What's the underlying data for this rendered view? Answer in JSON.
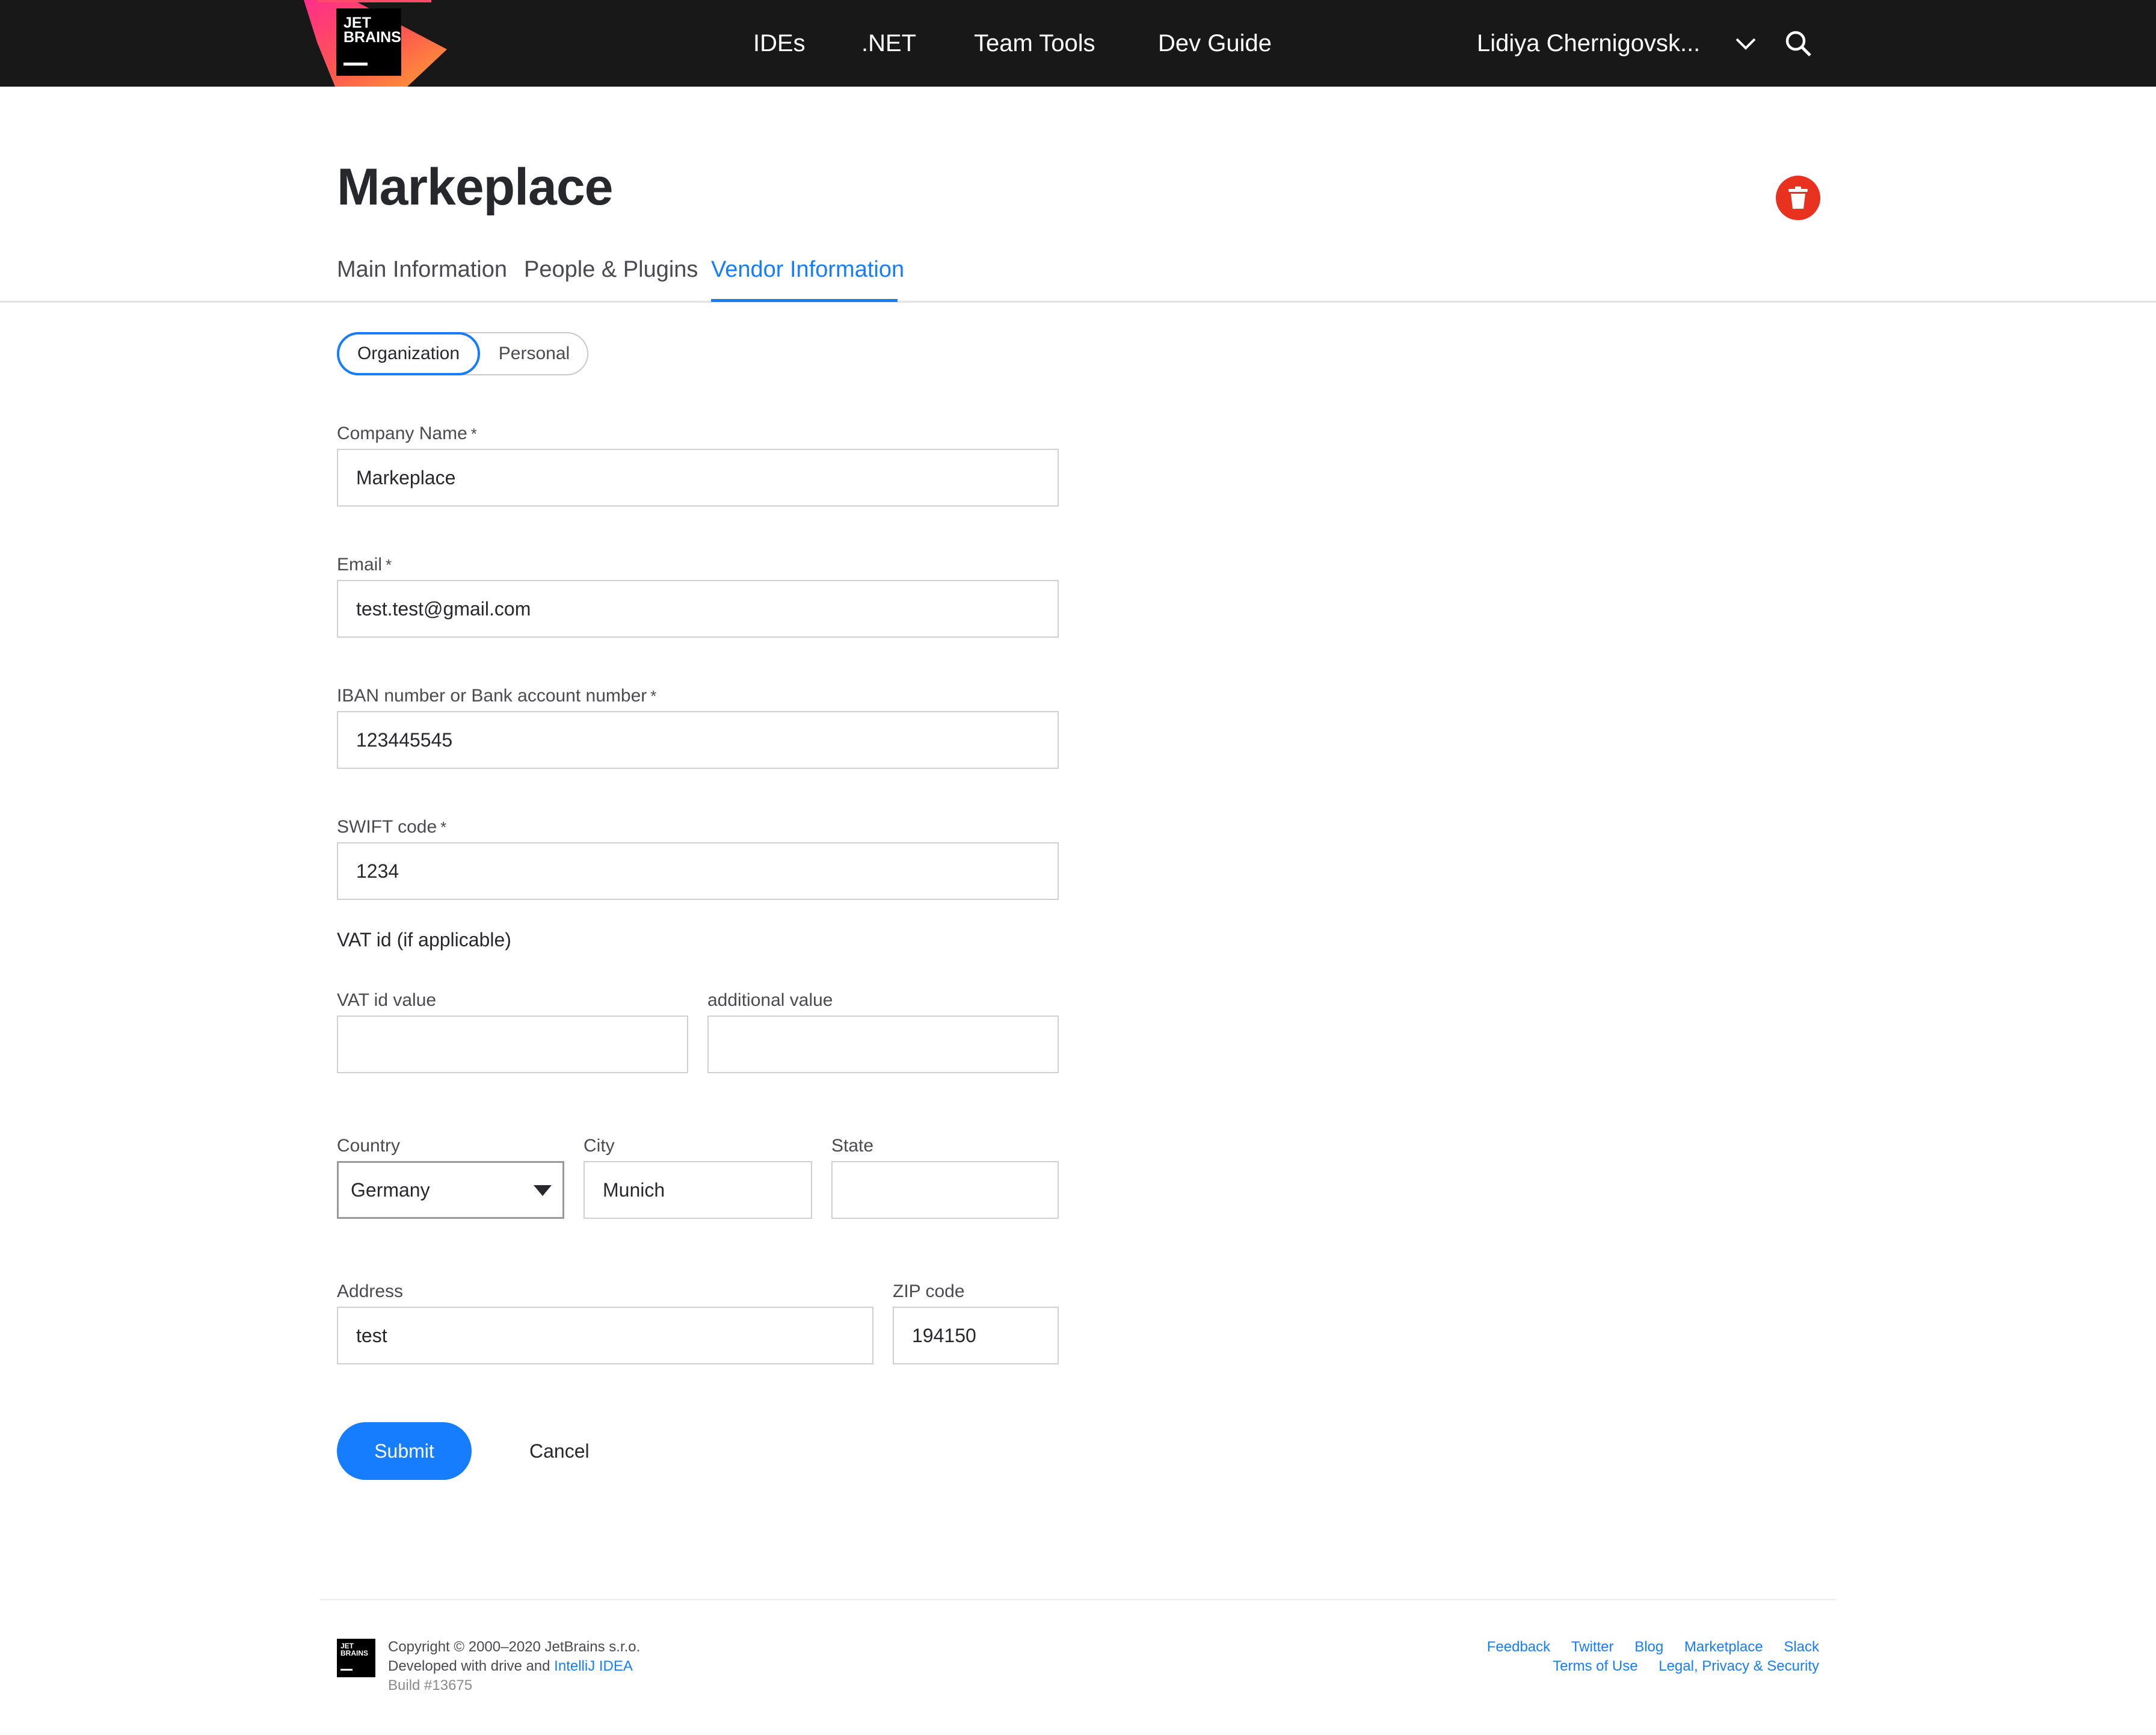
{
  "header": {
    "logo_text_line1": "JET",
    "logo_text_line2": "BRAINS",
    "nav": [
      "IDEs",
      ".NET",
      "Team Tools",
      "Dev Guide"
    ],
    "user_name": "Lidiya Chernigovsk..."
  },
  "page": {
    "title": "Markeplace",
    "tabs": [
      "Main Information",
      "People & Plugins",
      "Vendor Information"
    ],
    "active_tab": "Vendor Information"
  },
  "vendor_type": {
    "options": [
      "Organization",
      "Personal"
    ],
    "selected": "Organization"
  },
  "form": {
    "company_name": {
      "label": "Company Name",
      "value": "Markeplace"
    },
    "email": {
      "label": "Email",
      "value": "test.test@gmail.com"
    },
    "iban": {
      "label": "IBAN number or Bank account number",
      "value": "123445545"
    },
    "swift": {
      "label": "SWIFT code",
      "value": "1234"
    },
    "required_mark": "*",
    "vat_section": "VAT id (if applicable)",
    "vat_value": {
      "label": "VAT id value",
      "value": ""
    },
    "vat_additional": {
      "label": "additional value",
      "value": ""
    },
    "country": {
      "label": "Country",
      "value": "Germany"
    },
    "city": {
      "label": "City",
      "value": "Munich"
    },
    "state": {
      "label": "State",
      "value": ""
    },
    "address": {
      "label": "Address",
      "value": "test"
    },
    "zip": {
      "label": "ZIP code",
      "value": "194150"
    },
    "submit_label": "Submit",
    "cancel_label": "Cancel"
  },
  "footer": {
    "copyright": "Copyright © 2000–2020 JetBrains s.r.o.",
    "developed_prefix": "Developed with drive and",
    "developed_link": "IntelliJ IDEA",
    "build": "Build #13675",
    "links_row1": [
      "Feedback",
      "Twitter",
      "Blog",
      "Marketplace",
      "Slack"
    ],
    "links_row2": [
      "Terms of Use",
      "Legal, Privacy & Security"
    ]
  },
  "colors": {
    "accent": "#167dff",
    "header_bg": "#181818",
    "delete": "#e8321f"
  }
}
